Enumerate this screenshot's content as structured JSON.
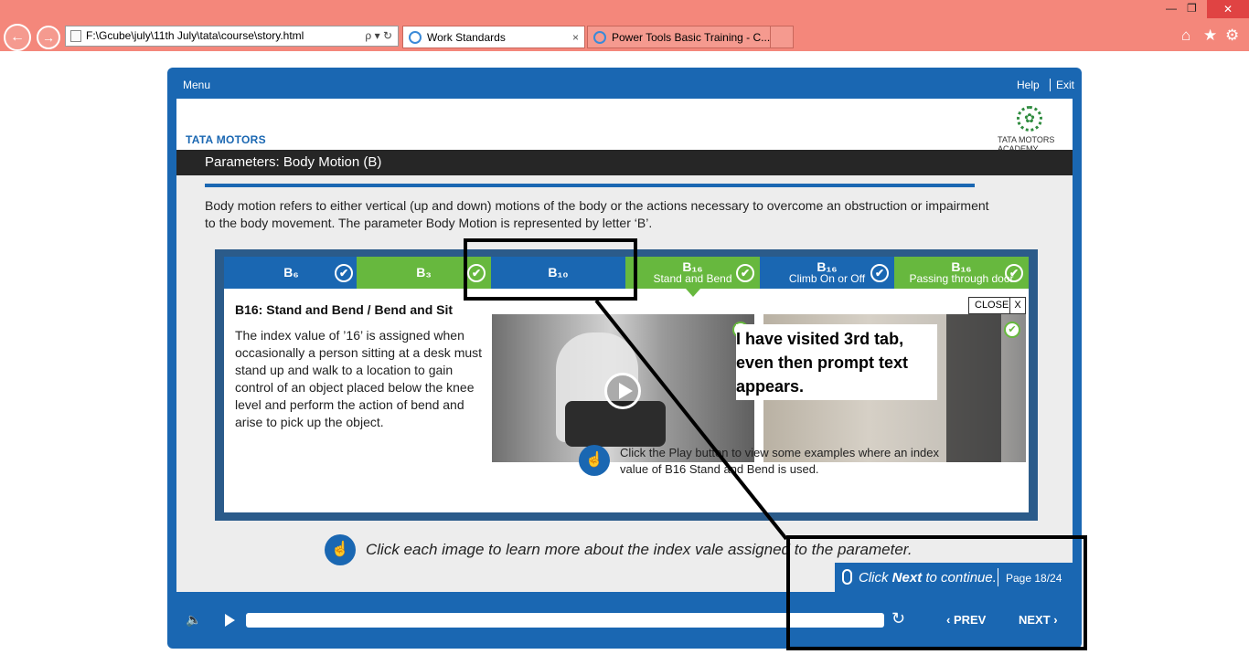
{
  "browser": {
    "address": "F:\\Gcube\\july\\11th July\\tata\\course\\story.html",
    "address_tools": "ρ ▾ ↻",
    "tabs": [
      {
        "label": "Work Standards",
        "close": "×"
      },
      {
        "label": "Power Tools Basic Training - C..."
      }
    ]
  },
  "player": {
    "menu_label": "Menu",
    "help_label": "Help",
    "exit_label": "Exit",
    "brand": "TATA MOTORS",
    "academy": "TATA MOTORS ACADEMY",
    "slide_title": "Parameters: Body Motion (B)",
    "intro": "Body motion refers to either vertical (up and down) motions of the body or the actions necessary to overcome an obstruction or impairment to the body movement. The parameter Body Motion is represented by letter ‘B’.",
    "tabs": [
      {
        "code": "B₆",
        "sub": "",
        "color": "blue",
        "visited": true
      },
      {
        "code": "B₃",
        "sub": "",
        "color": "green",
        "visited": true
      },
      {
        "code": "B₁₀",
        "sub": "",
        "color": "blue",
        "visited": false
      },
      {
        "code": "B₁₆",
        "sub": "Stand and Bend",
        "color": "green",
        "visited": true
      },
      {
        "code": "B₁₆",
        "sub": "Climb On or Off",
        "color": "blue",
        "visited": true
      },
      {
        "code": "B₁₆",
        "sub": "Passing through door",
        "color": "green",
        "visited": true
      }
    ],
    "detail_title": "B16: Stand and Bend / Bend and Sit",
    "detail_body": "The index value of ’16’ is assigned when occasionally a person sitting at a desk must stand up and walk to a location to gain control of an object placed below the knee level and perform the action of bend and arise to pick up the object.",
    "close_label": "CLOSE",
    "close_x": "X",
    "play_hint": "Click the Play button to view some examples where an index value of B16 Stand and Bend is used.",
    "bottom_hint": "Click each image to learn more about the index vale assigned to the parameter.",
    "next_hint_pre": "Click ",
    "next_hint_bold": "Next",
    "next_hint_post": " to continue.",
    "page_label": "Page  18/24",
    "prev_label": "PREV",
    "next_label": "NEXT",
    "progress": 0
  },
  "annotation": {
    "callout": "I have visited 3rd tab, even then prompt text appears."
  },
  "colors": {
    "chrome": "#f4877b",
    "player_blue": "#1a67b2",
    "tab_green": "#67b83e",
    "title_bar": "#262626"
  }
}
